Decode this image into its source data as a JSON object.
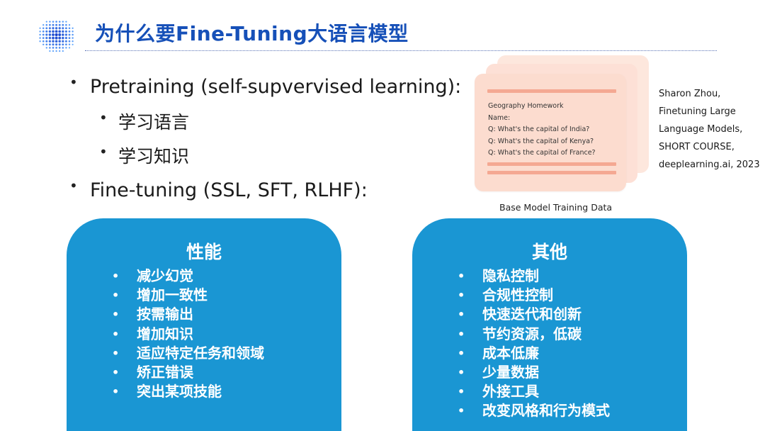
{
  "header": {
    "title": "为什么要Fine-Tuning大语言模型",
    "logo_icon": "blue-dot-sphere-icon",
    "accent_color": "#1650b8"
  },
  "bullets": [
    {
      "level": 1,
      "text": "Pretraining (self-supvervised learning):"
    },
    {
      "level": 2,
      "text": "学习语言"
    },
    {
      "level": 2,
      "text": "学习知识"
    },
    {
      "level": 1,
      "text": "Fine-tuning (SSL, SFT, RLHF):"
    }
  ],
  "illustration": {
    "card_lines": [
      "Geography Homework",
      "Name:",
      "Q: What's the capital of India?",
      "Q: What's the capital of Kenya?",
      "Q: What's the capital of France?"
    ],
    "caption": "Base Model Training Data",
    "card_color": "#fcdccf",
    "bar_color": "#f4a892"
  },
  "citation": {
    "lines": [
      "Sharon Zhou,",
      "Finetuning Large",
      "Language Models,",
      "SHORT COURSE,",
      "deeplearning.ai, 2023"
    ]
  },
  "panels": {
    "color": "#1a96d3",
    "left": {
      "title": "性能",
      "items": [
        "减少幻觉",
        "增加一致性",
        "按需输出",
        "增加知识",
        "适应特定任务和领域",
        "矫正错误",
        "突出某项技能"
      ]
    },
    "right": {
      "title": "其他",
      "items": [
        "隐私控制",
        "合规性控制",
        "快速迭代和创新",
        "节约资源，低碳",
        "成本低廉",
        "少量数据",
        "外接工具",
        "改变风格和行为模式"
      ]
    }
  }
}
